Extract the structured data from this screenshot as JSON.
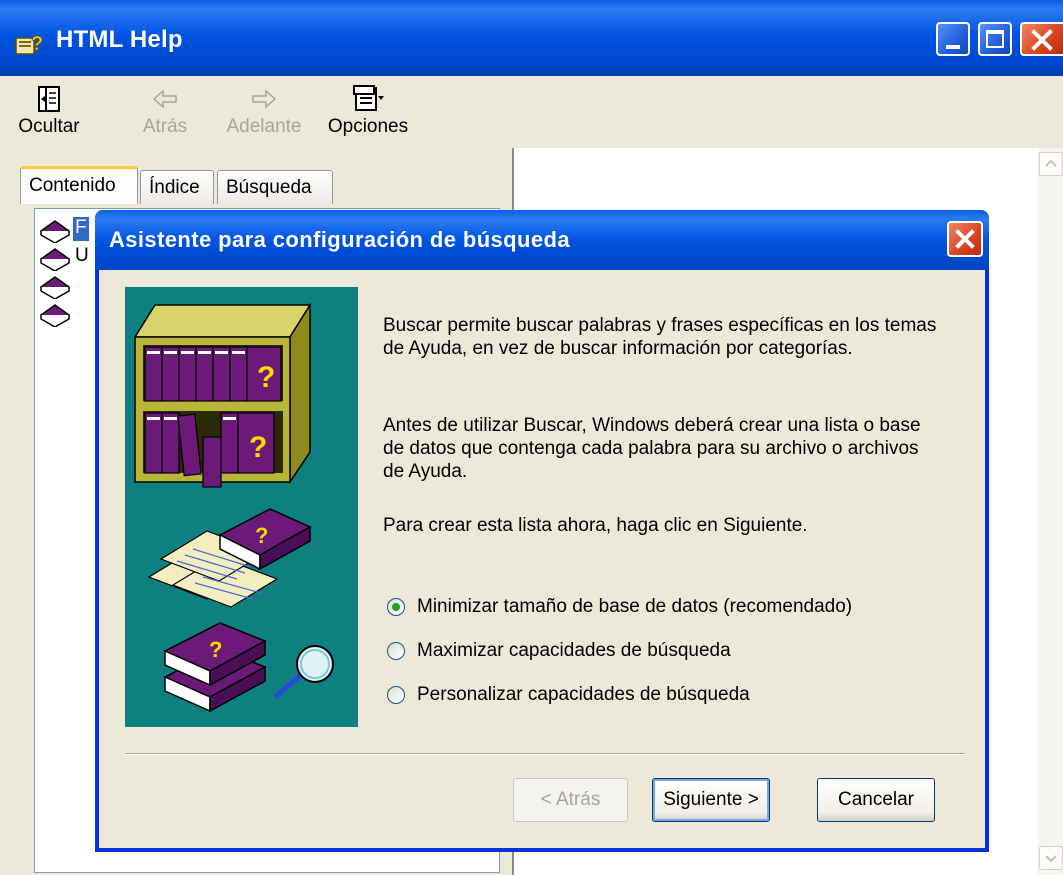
{
  "window": {
    "title": "HTML Help",
    "controls": [
      "minimize-icon",
      "maximize-icon",
      "close-icon"
    ]
  },
  "toolbar": {
    "items": [
      {
        "label": "Ocultar",
        "icon": "hide-pane-icon",
        "enabled": true
      },
      {
        "label": "Atrás",
        "icon": "back-arrow-icon",
        "enabled": false
      },
      {
        "label": "Adelante",
        "icon": "forward-arrow-icon",
        "enabled": false
      },
      {
        "label": "Opciones",
        "icon": "options-icon",
        "enabled": true
      }
    ]
  },
  "tabs": [
    {
      "label": "Contenido",
      "active": true
    },
    {
      "label": "Índice",
      "active": false
    },
    {
      "label": "Búsqueda",
      "active": false
    }
  ],
  "tree": {
    "items": [
      {
        "label": "F",
        "icon": "book-icon",
        "selected": true
      },
      {
        "label": "U",
        "icon": "book-icon",
        "selected": false
      },
      {
        "label": "",
        "icon": "book-icon",
        "selected": false
      },
      {
        "label": "",
        "icon": "book-icon",
        "selected": false
      }
    ]
  },
  "dialog": {
    "title": "Asistente para configuración de búsqueda",
    "paragraphs": [
      "Buscar permite buscar palabras y frases específicas en los temas de Ayuda, en vez de buscar información por categorías.",
      "Antes de utilizar Buscar, Windows deberá crear una lista o base de datos que contenga cada palabra para su archivo o archivos de Ayuda.",
      "Para crear esta lista ahora, haga clic en Siguiente."
    ],
    "options": [
      {
        "label": "Minimizar tamaño de base de datos (recomendado)",
        "selected": true
      },
      {
        "label": "Maximizar capacidades de búsqueda",
        "selected": false
      },
      {
        "label": "Personalizar capacidades de búsqueda",
        "selected": false
      }
    ],
    "buttons": {
      "back": "< Atrás",
      "next": "Siguiente >",
      "cancel": "Cancelar"
    }
  },
  "colors": {
    "titlebar_blue": "#0054e3",
    "dialog_border": "#0831d9",
    "illustration_bg": "#0f8080",
    "book_purple": "#6b1a78",
    "shelf_olive": "#b9b536",
    "selection_blue": "#316ac5"
  }
}
